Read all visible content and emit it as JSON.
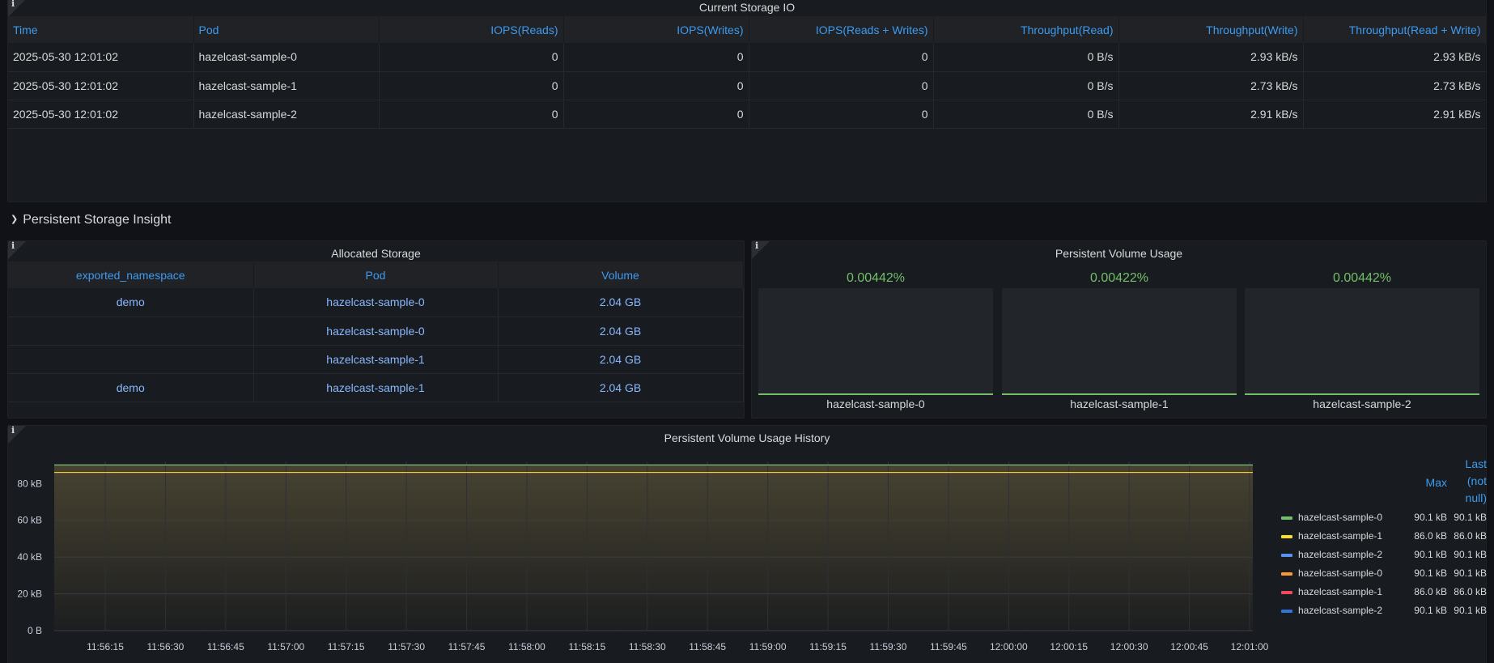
{
  "io_panel": {
    "title": "Current Storage IO",
    "columns": [
      "Time",
      "Pod",
      "IOPS(Reads)",
      "IOPS(Writes)",
      "IOPS(Reads + Writes)",
      "Throughput(Read)",
      "Throughput(Write)",
      "Throughput(Read + Write)"
    ],
    "rows": [
      [
        "2025-05-30 12:01:02",
        "hazelcast-sample-0",
        "0",
        "0",
        "0",
        "0 B/s",
        "2.93 kB/s",
        "2.93 kB/s"
      ],
      [
        "2025-05-30 12:01:02",
        "hazelcast-sample-1",
        "0",
        "0",
        "0",
        "0 B/s",
        "2.73 kB/s",
        "2.73 kB/s"
      ],
      [
        "2025-05-30 12:01:02",
        "hazelcast-sample-2",
        "0",
        "0",
        "0",
        "0 B/s",
        "2.91 kB/s",
        "2.91 kB/s"
      ]
    ]
  },
  "row_title": "Persistent Storage Insight",
  "allocated_panel": {
    "title": "Allocated Storage",
    "columns": [
      "exported_namespace",
      "Pod",
      "Volume"
    ],
    "rows": [
      [
        "demo",
        "hazelcast-sample-0",
        "2.04 GB"
      ],
      [
        "",
        "hazelcast-sample-0",
        "2.04 GB"
      ],
      [
        "",
        "hazelcast-sample-1",
        "2.04 GB"
      ],
      [
        "demo",
        "hazelcast-sample-1",
        "2.04 GB"
      ]
    ]
  },
  "usage_panel": {
    "title": "Persistent Volume Usage",
    "gauges": [
      {
        "value": "0.00442%",
        "label": "hazelcast-sample-0",
        "fraction": 4.42e-05
      },
      {
        "value": "0.00422%",
        "label": "hazelcast-sample-1",
        "fraction": 4.22e-05
      },
      {
        "value": "0.00442%",
        "label": "hazelcast-sample-2",
        "fraction": 4.42e-05
      }
    ]
  },
  "history_panel": {
    "title": "Persistent Volume Usage History",
    "legend_headers": {
      "max": "Max",
      "last_line1": "Last",
      "last_line2": "(not",
      "last_line3": "null)"
    },
    "legend": [
      {
        "name": "hazelcast-sample-0",
        "max": "90.1 kB",
        "last": "90.1 kB",
        "color": "#73bf69"
      },
      {
        "name": "hazelcast-sample-1",
        "max": "86.0 kB",
        "last": "86.0 kB",
        "color": "#fade2a"
      },
      {
        "name": "hazelcast-sample-2",
        "max": "90.1 kB",
        "last": "90.1 kB",
        "color": "#5794f2"
      },
      {
        "name": "hazelcast-sample-0",
        "max": "90.1 kB",
        "last": "90.1 kB",
        "color": "#ff9830"
      },
      {
        "name": "hazelcast-sample-1",
        "max": "86.0 kB",
        "last": "86.0 kB",
        "color": "#f2495c"
      },
      {
        "name": "hazelcast-sample-2",
        "max": "90.1 kB",
        "last": "90.1 kB",
        "color": "#3274d9"
      }
    ]
  },
  "chart_data": {
    "type": "line",
    "title": "Persistent Volume Usage History",
    "ylim": [
      0,
      92
    ],
    "yticks": [
      "0 B",
      "20 kB",
      "40 kB",
      "60 kB",
      "80 kB"
    ],
    "ytick_values": [
      0,
      20,
      40,
      60,
      80
    ],
    "x": [
      "11:56:15",
      "11:56:30",
      "11:56:45",
      "11:57:00",
      "11:57:15",
      "11:57:30",
      "11:57:45",
      "11:58:00",
      "11:58:15",
      "11:58:30",
      "11:58:45",
      "11:59:00",
      "11:59:15",
      "11:59:30",
      "11:59:45",
      "12:00:00",
      "12:00:15",
      "12:00:30",
      "12:00:45",
      "12:01:00"
    ],
    "grid": true,
    "series": [
      {
        "name": "hazelcast-sample-0",
        "value": 90.1,
        "color": "#73bf69"
      },
      {
        "name": "hazelcast-sample-1",
        "value": 86.0,
        "color": "#fade2a"
      },
      {
        "name": "hazelcast-sample-2",
        "value": 90.1,
        "color": "#5794f2"
      },
      {
        "name": "hazelcast-sample-0",
        "value": 90.1,
        "color": "#ff9830"
      },
      {
        "name": "hazelcast-sample-1",
        "value": 86.0,
        "color": "#f2495c"
      },
      {
        "name": "hazelcast-sample-2",
        "value": 90.1,
        "color": "#3274d9"
      }
    ]
  }
}
